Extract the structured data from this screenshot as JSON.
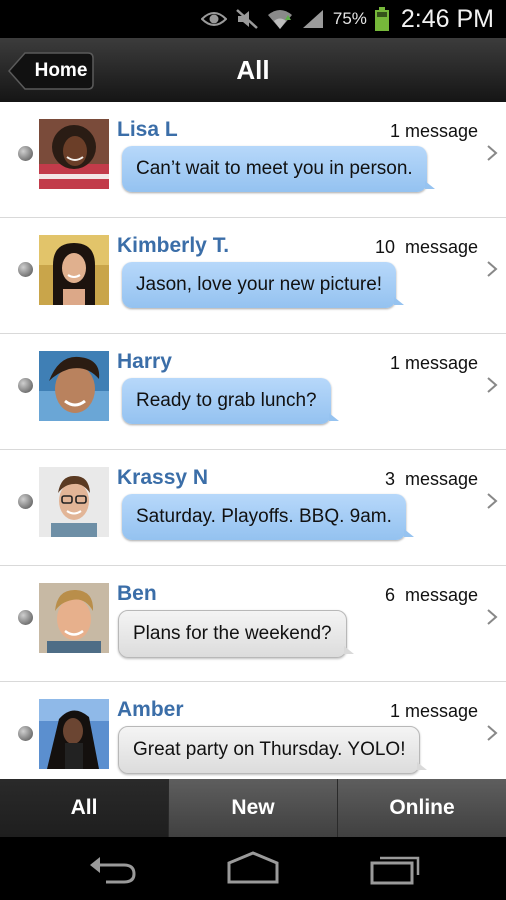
{
  "status_bar": {
    "battery_percent": "75%",
    "time": "2:46 PM",
    "icons": [
      "eye-icon",
      "mute-icon",
      "wifi-icon",
      "signal-icon",
      "battery-icon"
    ]
  },
  "header": {
    "back_label": "Home",
    "title": "All"
  },
  "conversations": [
    {
      "name": "Lisa L",
      "count": "1 message",
      "message": "Can’t wait to meet you in person.",
      "bubble_style": "blue",
      "avatar": "woman-curly-hair"
    },
    {
      "name": "Kimberly T.",
      "count": "10  message",
      "message": "Jason, love your new picture!",
      "bubble_style": "blue",
      "avatar": "woman-long-dark-hair"
    },
    {
      "name": "Harry",
      "count": "1 message",
      "message": "Ready to grab lunch?",
      "bubble_style": "blue",
      "avatar": "man-wet-hair"
    },
    {
      "name": "Krassy N",
      "count": "3  message",
      "message": "Saturday. Playoffs. BBQ. 9am.",
      "bubble_style": "blue",
      "avatar": "man-glasses"
    },
    {
      "name": "Ben",
      "count": "6  message",
      "message": "Plans for the weekend?",
      "bubble_style": "gray",
      "avatar": "man-blond"
    },
    {
      "name": "Amber",
      "count": "1 message",
      "message": "Great party on Thursday. YOLO!",
      "bubble_style": "gray",
      "avatar": "woman-dark-long-hair"
    }
  ],
  "tabs": [
    {
      "label": "All",
      "active": true
    },
    {
      "label": "New",
      "active": false
    },
    {
      "label": "Online",
      "active": false
    }
  ],
  "colors": {
    "name_blue": "#3b6ea8",
    "bubble_blue": "#a6cdf5",
    "bubble_gray": "#e6e6e6",
    "titlebar": "#2a2a2a"
  },
  "nav_icons": [
    "back-icon",
    "home-icon",
    "recent-apps-icon"
  ]
}
